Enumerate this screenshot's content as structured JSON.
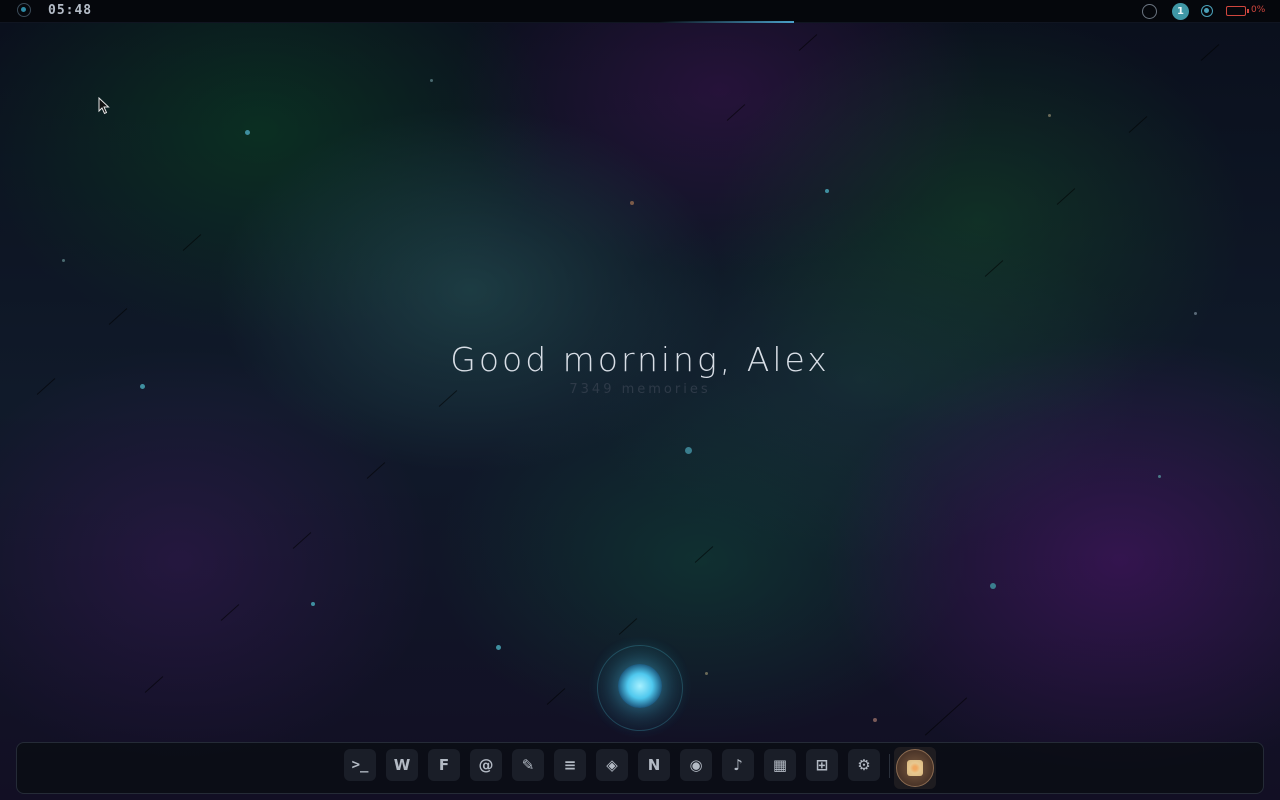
{
  "topbar": {
    "clock": "05:48",
    "workspace_number": "1",
    "battery_percent": "0%",
    "icons": {
      "logo": "os-logo-icon",
      "tray_status": "circle-status-icon",
      "network": "network-icon",
      "battery": "battery-icon"
    }
  },
  "desktop": {
    "greeting": "Good morning, Alex",
    "memories_count": "7349 memories"
  },
  "colors": {
    "accent": "#4aa0c8",
    "battery_low": "#d0463e",
    "workspace_badge": "#3f97a6",
    "orb": "#4fc8ee"
  },
  "dock": {
    "items": [
      {
        "label": ">_",
        "icon": "terminal-icon",
        "app": "terminal"
      },
      {
        "label": "W",
        "icon": "browser-icon",
        "app": "web"
      },
      {
        "label": "F",
        "icon": "files-icon",
        "app": "files"
      },
      {
        "label": "@",
        "icon": "mail-icon",
        "app": "mail"
      },
      {
        "label": "✎",
        "icon": "pencil-icon",
        "app": "editor"
      },
      {
        "label": "≡",
        "icon": "list-icon",
        "app": "tasks"
      },
      {
        "label": "◈",
        "icon": "diamond-icon",
        "app": "code"
      },
      {
        "label": "N",
        "icon": "notes-icon",
        "app": "notes"
      },
      {
        "label": "◉",
        "icon": "camera-icon",
        "app": "camera"
      },
      {
        "label": "♪",
        "icon": "music-icon",
        "app": "music"
      },
      {
        "label": "▦",
        "icon": "calendar-icon",
        "app": "calendar"
      },
      {
        "label": "⊞",
        "icon": "apps-grid-icon",
        "app": "apps"
      },
      {
        "label": "⚙",
        "icon": "gear-icon",
        "app": "settings"
      }
    ],
    "active_app_icon": "photo-app-icon"
  }
}
